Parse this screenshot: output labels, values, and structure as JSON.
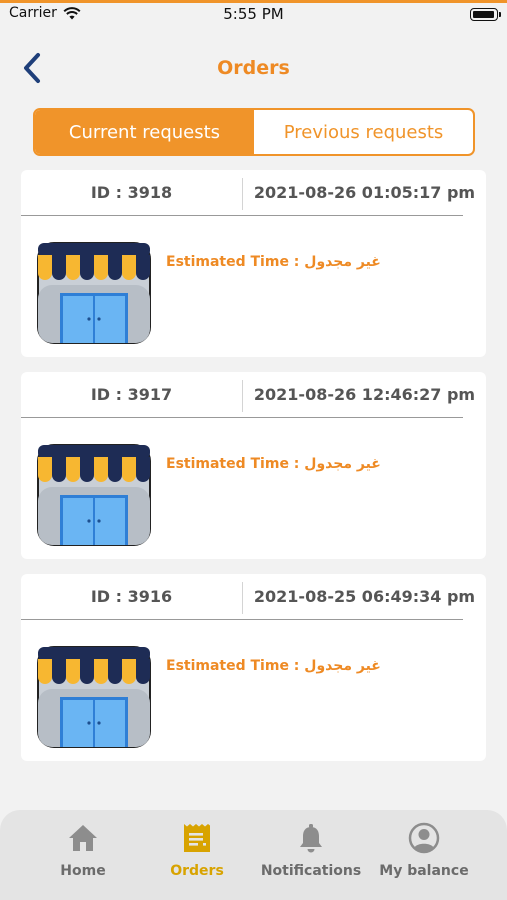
{
  "status_bar": {
    "carrier": "Carrier",
    "time": "5:55 PM"
  },
  "nav": {
    "title": "Orders",
    "back_icon": "chevron-left-icon"
  },
  "segments": {
    "current": "Current requests",
    "previous": "Previous requests",
    "selected": "current"
  },
  "orders": [
    {
      "id_text": "ID : 3918",
      "date": "2021-08-26 01:05:17 pm",
      "eta_text": "Estimated Time : غير مجدول"
    },
    {
      "id_text": "ID : 3917",
      "date": "2021-08-26 12:46:27 pm",
      "eta_text": "Estimated Time : غير مجدول"
    },
    {
      "id_text": "ID : 3916",
      "date": "2021-08-25 06:49:34 pm",
      "eta_text": "Estimated Time : غير مجدول"
    }
  ],
  "tab_bar": {
    "active": "orders",
    "items": [
      {
        "key": "home",
        "label": "Home",
        "icon": "home-icon"
      },
      {
        "key": "orders",
        "label": "Orders",
        "icon": "receipt-icon"
      },
      {
        "key": "notifications",
        "label": "Notifications",
        "icon": "bell-icon"
      },
      {
        "key": "balance",
        "label": "My balance",
        "icon": "user-icon"
      }
    ]
  },
  "colors": {
    "accent": "#f0942a",
    "title": "#ee8a24",
    "tab_active": "#d8a300",
    "tab_inactive": "#6b6b6b",
    "background": "#f2f2f2"
  }
}
